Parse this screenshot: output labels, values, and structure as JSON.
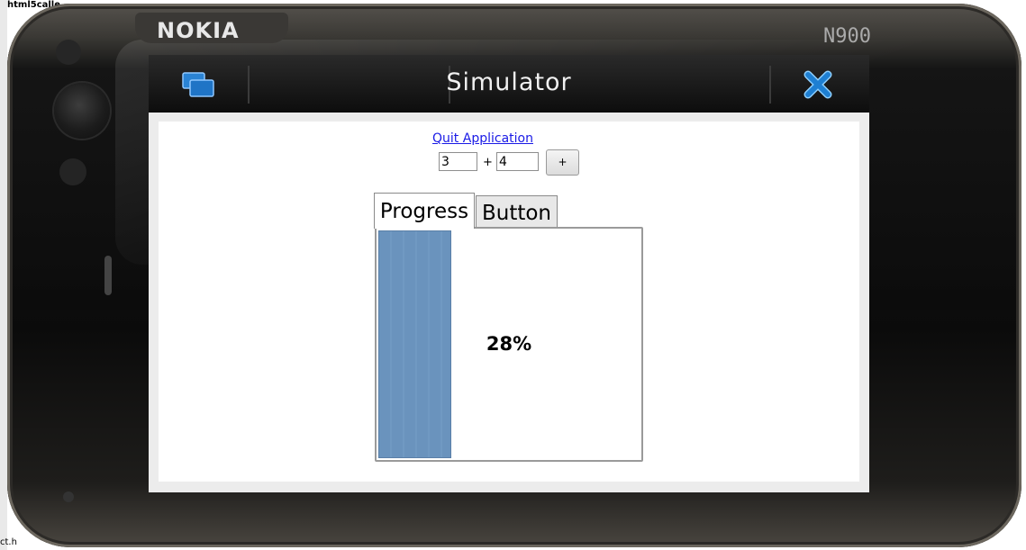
{
  "device": {
    "brand": "NOKIA",
    "model": "N900"
  },
  "simulator": {
    "title": "Simulator",
    "task_switcher_icon": "task-switcher-icon",
    "close_icon": "close-icon"
  },
  "app": {
    "quit_link": "Quit Application",
    "operand_a": "3",
    "plus_sign": "+",
    "operand_b": "4",
    "add_button_label": "+",
    "tabs": [
      {
        "label": "Progress",
        "selected": true
      },
      {
        "label": "Button",
        "selected": false
      }
    ],
    "progress": {
      "value": 0.28,
      "label": "28%",
      "color": "#6a93bd"
    }
  },
  "desktop_fragments": {
    "top_title": "html5calle",
    "bottom_tail": "ct.h"
  }
}
